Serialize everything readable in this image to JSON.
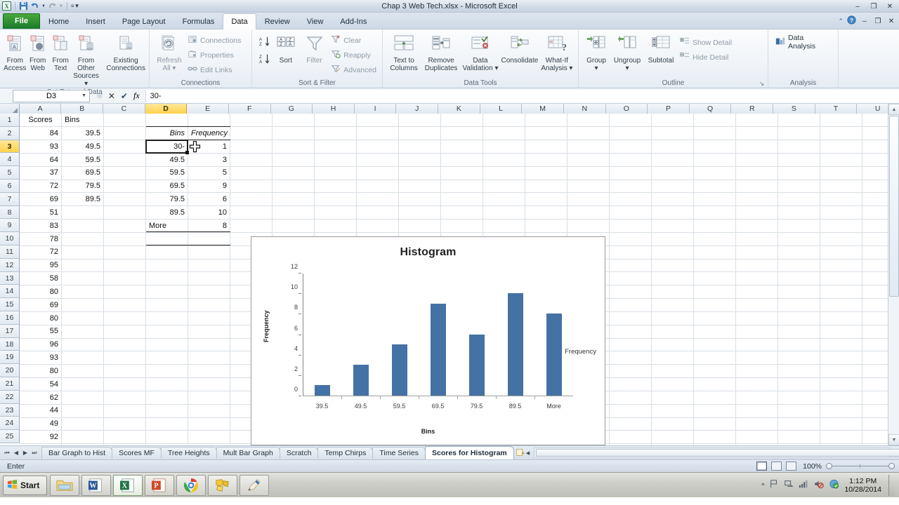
{
  "window": {
    "title": "Chap 3 Web Tech.xlsx  -  Microsoft Excel",
    "quick_access": [
      "save-icon",
      "undo-icon",
      "redo-icon",
      "customize-icon"
    ],
    "controls": {
      "help": "?",
      "minimize": "–",
      "restore": "❐",
      "close": "✕",
      "ribbon_collapse": "⌃"
    }
  },
  "ribbon": {
    "file_tab": "File",
    "tabs": [
      {
        "label": "Home",
        "active": false
      },
      {
        "label": "Insert",
        "active": false
      },
      {
        "label": "Page Layout",
        "active": false
      },
      {
        "label": "Formulas",
        "active": false
      },
      {
        "label": "Data",
        "active": true
      },
      {
        "label": "Review",
        "active": false
      },
      {
        "label": "View",
        "active": false
      },
      {
        "label": "Add-Ins",
        "active": false
      }
    ],
    "groups": [
      {
        "name": "Get External Data",
        "buttons": [
          {
            "label_1": "From",
            "label_2": "Access",
            "icon": "from-access-icon"
          },
          {
            "label_1": "From",
            "label_2": "Web",
            "icon": "from-web-icon"
          },
          {
            "label_1": "From",
            "label_2": "Text",
            "icon": "from-text-icon"
          },
          {
            "label_1": "From Other",
            "label_2": "Sources ▾",
            "icon": "from-other-sources-icon"
          },
          {
            "label_1": "Existing",
            "label_2": "Connections",
            "icon": "existing-connections-icon"
          }
        ]
      },
      {
        "name": "Connections",
        "big": [
          {
            "label_1": "Refresh",
            "label_2": "All ▾",
            "icon": "refresh-all-icon"
          }
        ],
        "small": [
          {
            "label": "Connections",
            "icon": "connections-icon",
            "disabled": true
          },
          {
            "label": "Properties",
            "icon": "properties-icon",
            "disabled": true
          },
          {
            "label": "Edit Links",
            "icon": "edit-links-icon",
            "disabled": true
          }
        ]
      },
      {
        "name": "Sort & Filter",
        "sort_az": "A↓",
        "sort_za": "Z↑",
        "big": [
          {
            "label_1": "Sort",
            "label_2": "",
            "icon": "sort-icon"
          },
          {
            "label_1": "Filter",
            "label_2": "",
            "icon": "filter-icon"
          }
        ],
        "small": [
          {
            "label": "Clear",
            "icon": "clear-filter-icon",
            "disabled": true
          },
          {
            "label": "Reapply",
            "icon": "reapply-filter-icon",
            "disabled": true
          },
          {
            "label": "Advanced",
            "icon": "advanced-filter-icon",
            "disabled": true
          }
        ]
      },
      {
        "name": "Data Tools",
        "buttons": [
          {
            "label_1": "Text to",
            "label_2": "Columns",
            "icon": "text-to-columns-icon"
          },
          {
            "label_1": "Remove",
            "label_2": "Duplicates",
            "icon": "remove-duplicates-icon"
          },
          {
            "label_1": "Data",
            "label_2": "Validation ▾",
            "icon": "data-validation-icon"
          },
          {
            "label_1": "Consolidate",
            "label_2": "",
            "icon": "consolidate-icon"
          },
          {
            "label_1": "What-If",
            "label_2": "Analysis ▾",
            "icon": "what-if-analysis-icon"
          }
        ]
      },
      {
        "name": "Outline",
        "buttons": [
          {
            "label_1": "Group",
            "label_2": "▾",
            "icon": "group-icon"
          },
          {
            "label_1": "Ungroup",
            "label_2": "▾",
            "icon": "ungroup-icon"
          },
          {
            "label_1": "Subtotal",
            "label_2": "",
            "icon": "subtotal-icon"
          }
        ],
        "small": [
          {
            "label": "Show Detail",
            "icon": "show-detail-icon",
            "disabled": true
          },
          {
            "label": "Hide Detail",
            "icon": "hide-detail-icon",
            "disabled": true
          }
        ],
        "dialog_launcher": "↘"
      },
      {
        "name": "Analysis",
        "small": [
          {
            "label": "Data Analysis",
            "icon": "data-analysis-icon",
            "disabled": false
          }
        ]
      }
    ]
  },
  "formula_bar": {
    "name_box": "D3",
    "cancel_icon": "✕",
    "enter_icon": "✔",
    "function_icon": "fx",
    "value": "30-"
  },
  "grid": {
    "columns": [
      "A",
      "B",
      "C",
      "D",
      "E",
      "F",
      "G",
      "H",
      "I",
      "J",
      "K",
      "L",
      "M",
      "N",
      "O",
      "P",
      "Q",
      "R",
      "S",
      "T",
      "U"
    ],
    "selected_column": "D",
    "selected_row": 3,
    "rows": [
      1,
      2,
      3,
      4,
      5,
      6,
      7,
      8,
      9,
      10,
      11,
      12,
      13,
      14,
      15,
      16,
      17,
      18,
      19,
      20,
      21,
      22,
      23,
      24,
      25
    ],
    "cells": {
      "A1": "Scores",
      "B1": "Bins",
      "A2": "84",
      "B2": "39.5",
      "A3": "93",
      "B3": "49.5",
      "A4": "64",
      "B4": "59.5",
      "A5": "37",
      "B5": "69.5",
      "A6": "72",
      "B6": "79.5",
      "A7": "69",
      "B7": "89.5",
      "A8": "51",
      "A9": "83",
      "A10": "78",
      "A11": "72",
      "A12": "95",
      "A13": "58",
      "A14": "80",
      "A15": "69",
      "A16": "80",
      "A17": "55",
      "A18": "96",
      "A19": "93",
      "A20": "80",
      "A21": "54",
      "A22": "62",
      "A23": "44",
      "A24": "49",
      "A25": "92",
      "D2": "Bins",
      "E2": "Frequency",
      "D3": "30-",
      "E3": "1",
      "D4": "49.5",
      "E4": "3",
      "D5": "59.5",
      "E5": "5",
      "D6": "69.5",
      "E6": "9",
      "D7": "79.5",
      "E7": "6",
      "D8": "89.5",
      "E8": "10",
      "D9": "More",
      "E9": "8"
    },
    "editing_cell": "D3",
    "mouse_cursor": "text-select-plus-cursor"
  },
  "chart_data": {
    "type": "bar",
    "title": "Histogram",
    "xlabel": "Bins",
    "ylabel": "Frequency",
    "categories": [
      "39.5",
      "49.5",
      "59.5",
      "69.5",
      "79.5",
      "89.5",
      "More"
    ],
    "values": [
      1,
      3,
      5,
      9,
      6,
      10,
      8
    ],
    "series": [
      {
        "name": "Frequency",
        "values": [
          1,
          3,
          5,
          9,
          6,
          10,
          8
        ]
      }
    ],
    "yticks": [
      0,
      2,
      4,
      6,
      8,
      10,
      12
    ],
    "ylim": [
      0,
      12
    ],
    "grid": false,
    "legend": [
      "Frequency"
    ],
    "legend_position": "right",
    "bar_color": "#4472a4"
  },
  "sheet_tabs": {
    "nav": [
      "⏮",
      "◀",
      "▶",
      "⏭"
    ],
    "tabs": [
      {
        "label": "Bar Graph to Hist",
        "active": false
      },
      {
        "label": "Scores MF",
        "active": false
      },
      {
        "label": "Tree Heights",
        "active": false
      },
      {
        "label": "Mult Bar Graph",
        "active": false
      },
      {
        "label": "Scratch",
        "active": false
      },
      {
        "label": "Temp Chirps",
        "active": false
      },
      {
        "label": "Time Series",
        "active": false
      },
      {
        "label": "Scores for Histogram",
        "active": true
      }
    ],
    "new_sheet_icon": "insert-worksheet-icon"
  },
  "status_bar": {
    "mode": "Enter",
    "views": [
      "normal-view-icon",
      "page-layout-view-icon",
      "page-break-preview-icon"
    ],
    "active_view": 0,
    "zoom": "100%"
  },
  "taskbar": {
    "start_label": "Start",
    "buttons": [
      {
        "name": "file-explorer-icon",
        "active": false
      },
      {
        "name": "word-icon",
        "active": false
      },
      {
        "name": "excel-icon",
        "active": true
      },
      {
        "name": "powerpoint-icon",
        "active": false
      },
      {
        "name": "chrome-icon",
        "active": false
      },
      {
        "name": "jigsaw-app-icon",
        "active": false
      },
      {
        "name": "paint-pen-icon",
        "active": false
      }
    ],
    "tray": [
      "show-hidden-icons",
      "flag-action-center-icon",
      "network-icon",
      "signal-icon",
      "volume-muted-icon",
      "update-icon"
    ],
    "time": "1:12 PM",
    "date": "10/28/2014"
  }
}
